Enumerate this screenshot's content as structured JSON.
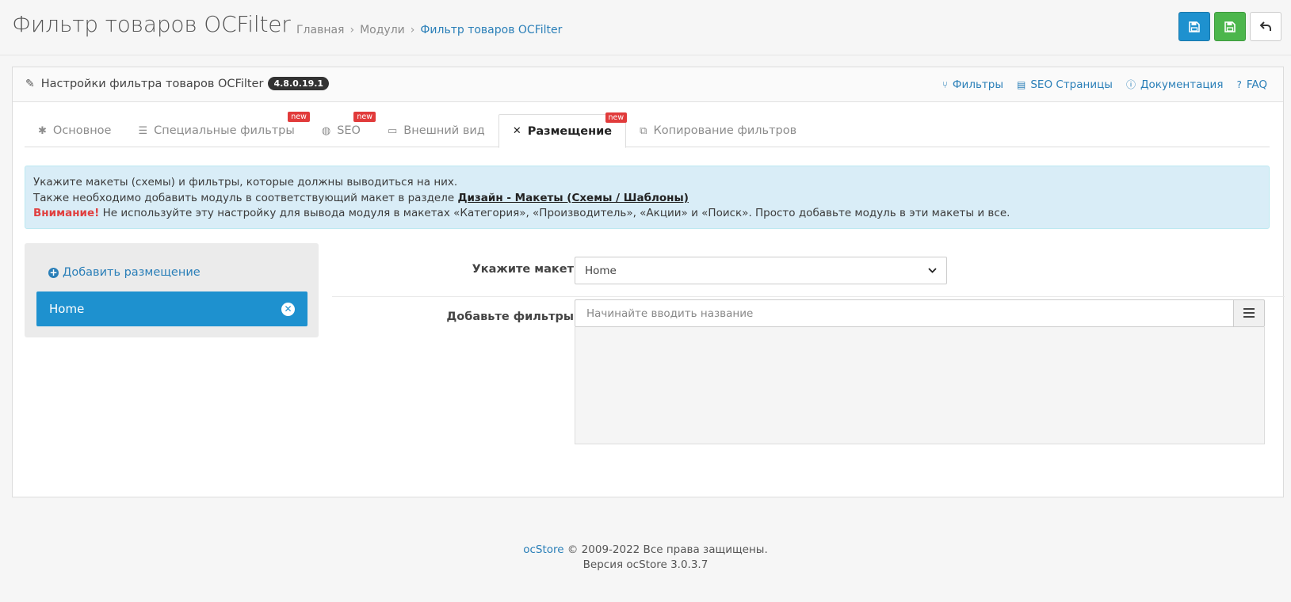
{
  "header": {
    "title": "Фильтр товаров OCFilter",
    "breadcrumbs": [
      "Главная",
      "Модули",
      "Фильтр товаров OCFilter"
    ],
    "buttons": {
      "save": "save-icon",
      "save_stay": "save-icon",
      "back": "undo-icon"
    }
  },
  "panel": {
    "title": "Настройки фильтра товаров OCFilter",
    "version": "4.8.0.19.1",
    "links": [
      "Фильтры",
      "SEO Страницы",
      "Документация",
      "FAQ"
    ]
  },
  "tabs": [
    {
      "label": "Основное",
      "new": ""
    },
    {
      "label": "Специальные фильтры",
      "new": "new"
    },
    {
      "label": "SEO",
      "new": "new"
    },
    {
      "label": "Внешний вид",
      "new": ""
    },
    {
      "label": "Размещение",
      "new": "new",
      "active": true
    },
    {
      "label": "Копирование фильтров",
      "new": ""
    }
  ],
  "alert": {
    "line1": "Укажите макеты (схемы) и фильтры, которые должны выводиться на них.",
    "line2_prefix": "Также необходимо добавить модуль в соответствующий макет в разделе ",
    "line2_link": "Дизайн - Макеты (Схемы / Шаблоны)",
    "warning_label": "Внимание!",
    "warning_text": " Не используйте эту настройку для вывода модуля в макетах «Категория», «Производитель», «Акции» и «Поиск». Просто добавьте модуль в эти макеты и все."
  },
  "placement": {
    "add_label": "Добавить размещение",
    "items": [
      {
        "label": "Home"
      }
    ]
  },
  "form": {
    "layout_label": "Укажите макет",
    "layout_value": "Home",
    "filters_label": "Добавьте фильтры",
    "filters_placeholder": "Начинайте вводить название"
  },
  "footer": {
    "brand": "ocStore",
    "copyright": " © 2009-2022 Все права защищены.",
    "version": "Версия ocStore 3.0.3.7"
  },
  "colors": {
    "primary": "#1e91cf",
    "success": "#4cb64c",
    "link": "#2a7fb8",
    "alert_bg": "#d9edf7",
    "warning": "#e04040"
  }
}
